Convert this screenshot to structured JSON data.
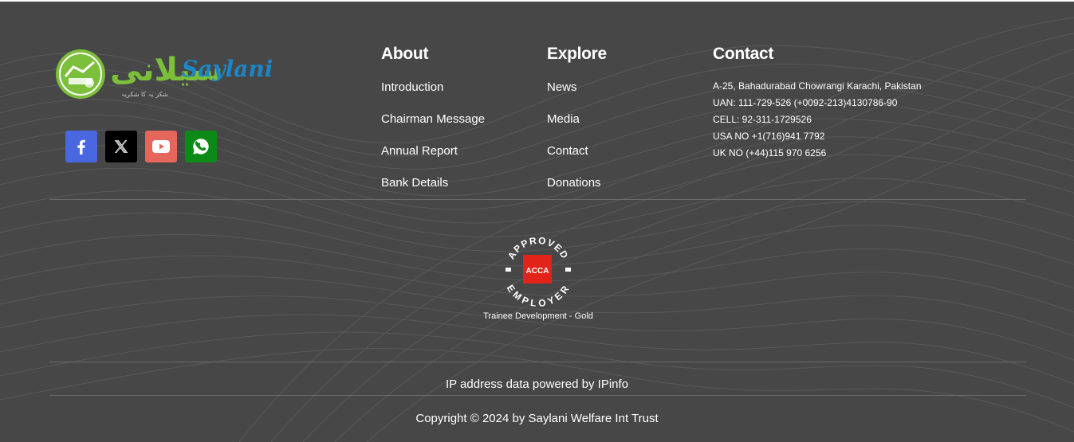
{
  "logo": {
    "urdu_text": "سیلانی",
    "english_text": "Saylani",
    "tagline": "شکر یہ کا شکریہ"
  },
  "social": [
    {
      "name": "facebook",
      "icon": "facebook-icon",
      "color": "#4a67e2"
    },
    {
      "name": "x",
      "icon": "x-icon",
      "color": "#000000"
    },
    {
      "name": "youtube",
      "icon": "youtube-icon",
      "color": "#e5665a"
    },
    {
      "name": "whatsapp",
      "icon": "whatsapp-icon",
      "color": "#0c8a17"
    }
  ],
  "about": {
    "heading": "About",
    "links": [
      "Introduction",
      "Chairman Message",
      "Annual Report",
      "Bank Details"
    ]
  },
  "explore": {
    "heading": "Explore",
    "links": [
      "News",
      "Media",
      "Contact",
      "Donations"
    ]
  },
  "contact": {
    "heading": "Contact",
    "lines": [
      "A-25, Bahadurabad Chowrangi Karachi, Pakistan",
      "UAN: 111-729-526 (+0092-213)4130786-90",
      "CELL: 92-311-1729526",
      "USA NO +1(716)941 7792",
      "UK NO (+44)115 970 6256"
    ]
  },
  "badge": {
    "top_text": "APPROVED",
    "bottom_text": "EMPLOYER",
    "center_text": "ACCA",
    "caption": "Trainee Development - Gold"
  },
  "ipinfo": {
    "prefix": "IP address data powered by ",
    "link": "IPinfo"
  },
  "copyright": "Copyright © 2024 by Saylani Welfare Int Trust",
  "colors": {
    "background": "#474747",
    "logo_green": "#7bbf3a",
    "logo_blue": "#1d86c6",
    "acca_red": "#e2231a"
  }
}
